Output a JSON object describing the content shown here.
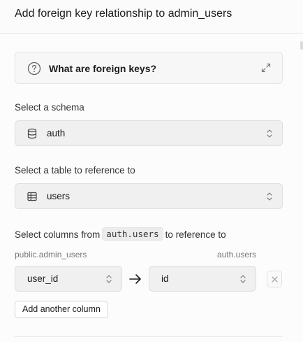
{
  "header": {
    "title": "Add foreign key relationship to admin_users"
  },
  "info": {
    "label": "What are foreign keys?",
    "icon": "question-circle-icon",
    "expand_icon": "expand-arrows-icon"
  },
  "schema": {
    "label": "Select a schema",
    "value": "auth",
    "icon": "database-icon"
  },
  "table": {
    "label": "Select a table to reference to",
    "value": "users",
    "icon": "table-grid-icon"
  },
  "columns": {
    "label_prefix": "Select columns from",
    "label_code": "auth.users",
    "label_suffix": "to reference to",
    "source_table": "public.admin_users",
    "target_table": "auth.users",
    "source_column": "user_id",
    "target_column": "id"
  },
  "add_column_button": "Add another column",
  "colors": {
    "background": "#fcfcfc",
    "select_background": "#f0f0f0",
    "border": "#dedede"
  }
}
